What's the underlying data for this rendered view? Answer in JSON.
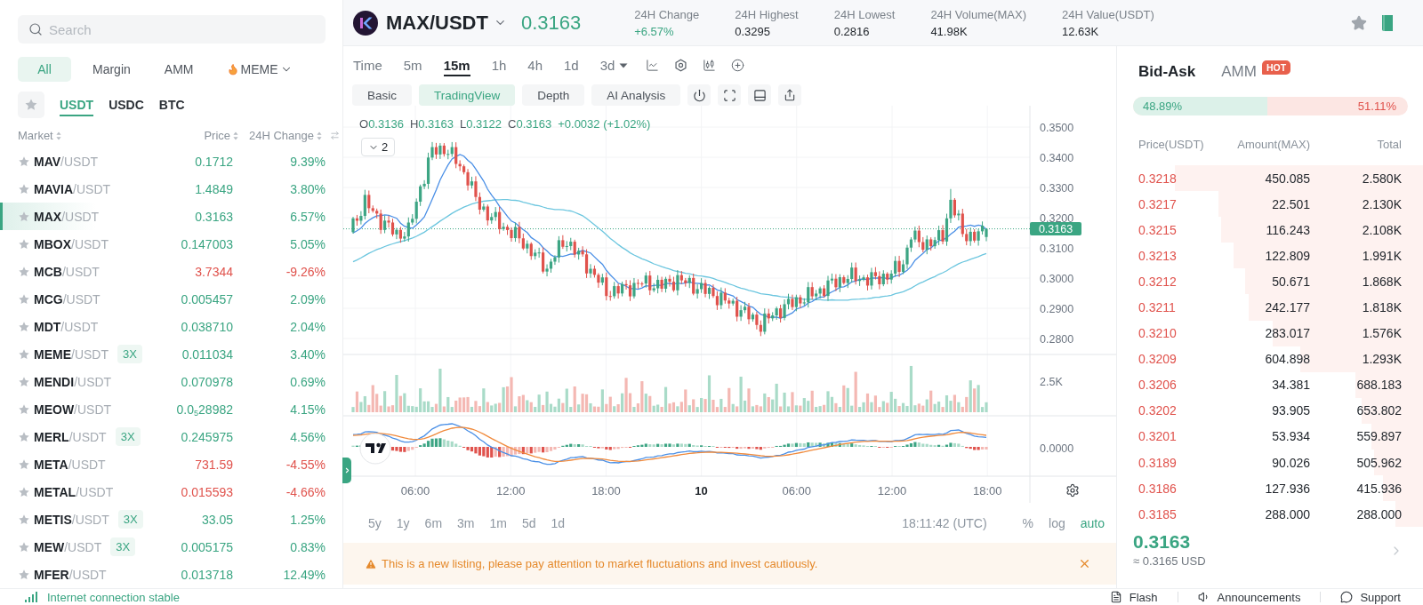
{
  "market_list": {
    "search": {
      "placeholder": "Search"
    },
    "categories": [
      {
        "label": "All",
        "selected": true,
        "kind": "tab"
      },
      {
        "label": "Margin",
        "selected": false,
        "kind": "tab"
      },
      {
        "label": "AMM",
        "selected": false,
        "kind": "tab"
      },
      {
        "label": "MEME",
        "selected": false,
        "kind": "hot-menu"
      }
    ],
    "quote_tabs": [
      {
        "label": "USDT",
        "selected": true
      },
      {
        "label": "USDC",
        "selected": false
      },
      {
        "label": "BTC",
        "selected": false
      }
    ],
    "columns": [
      "Market",
      "Price",
      "24H Change"
    ],
    "rows": [
      {
        "pair": "**MAV**/USDT",
        "price": "0.1712",
        "change": "9.39%",
        "falling": false,
        "selected": false
      },
      {
        "pair": "**MAVIA**/USDT",
        "price": "1.4849",
        "change": "3.80%",
        "falling": false,
        "selected": false
      },
      {
        "pair": "**MAX**/USDT",
        "price": "0.3163",
        "change": "6.57%",
        "falling": false,
        "selected": true
      },
      {
        "pair": "**MBOX**/USDT",
        "price": "0.147003",
        "change": "5.05%",
        "falling": false,
        "selected": false
      },
      {
        "pair": "**MCB**/USDT",
        "price": "3.7344",
        "change": "-9.26%",
        "falling": true,
        "selected": false
      },
      {
        "pair": "**MCG**/USDT",
        "price": "0.005457",
        "change": "2.09%",
        "falling": false,
        "selected": false
      },
      {
        "pair": "**MDT**/USDT",
        "price": "0.038710",
        "change": "2.04%",
        "falling": false,
        "selected": false
      },
      {
        "pair": "**MEME**/USDT",
        "leverage": "3X",
        "price": "0.011034",
        "change": "3.40%",
        "falling": false,
        "selected": false
      },
      {
        "pair": "**MENDI**/USDT",
        "price": "0.070978",
        "change": "0.69%",
        "falling": false,
        "selected": false
      },
      {
        "pair": "**MEOW**/USDT",
        "price": "0.0$_{5}$28982",
        "change": "4.15%",
        "falling": false,
        "selected": false
      },
      {
        "pair": "**MERL**/USDT",
        "leverage": "3X",
        "price": "0.245975",
        "change": "4.56%",
        "falling": false,
        "selected": false
      },
      {
        "pair": "**META**/USDT",
        "price": "731.59",
        "change": "-4.55%",
        "falling": true,
        "selected": false
      },
      {
        "pair": "**METAL**/USDT",
        "price": "0.015593",
        "change": "-4.66%",
        "falling": true,
        "selected": false
      },
      {
        "pair": "**METIS**/USDT",
        "leverage": "3X",
        "price": "33.05",
        "change": "1.25%",
        "falling": false,
        "selected": false
      },
      {
        "pair": "**MEW**/USDT",
        "leverage": "3X",
        "price": "0.005175",
        "change": "0.83%",
        "falling": false,
        "selected": false
      },
      {
        "pair": "**MFER**/USDT",
        "price": "0.013718",
        "change": "12.49%",
        "falling": false,
        "selected": false
      }
    ]
  },
  "header": {
    "symbol": "MAX/USDT",
    "price": "0.3163",
    "stats": [
      {
        "label": "24H Change",
        "value": "+6.57%",
        "kind": "change"
      },
      {
        "label": "24H Highest",
        "value": "0.3295",
        "kind": "figure"
      },
      {
        "label": "24H Lowest",
        "value": "0.2816",
        "kind": "figure"
      },
      {
        "label": "24H Volume(MAX)",
        "value": "41.98K",
        "kind": "figure"
      },
      {
        "label": "24H Value(USDT)",
        "value": "12.63K",
        "kind": "figure"
      }
    ]
  },
  "chart": {
    "intervals": [
      {
        "label": "Time",
        "selected": false,
        "kind": "option"
      },
      {
        "label": "5m",
        "selected": false,
        "kind": "option"
      },
      {
        "label": "15m",
        "selected": true,
        "kind": "option"
      },
      {
        "label": "1h",
        "selected": false,
        "kind": "option"
      },
      {
        "label": "4h",
        "selected": false,
        "kind": "option"
      },
      {
        "label": "1d",
        "selected": false,
        "kind": "option"
      },
      {
        "label": "3d",
        "selected": false,
        "kind": "menu"
      }
    ],
    "views": [
      {
        "label": "Basic",
        "selected": false
      },
      {
        "label": "TradingView",
        "selected": true
      },
      {
        "label": "Depth",
        "selected": false
      },
      {
        "label": "AI Analysis",
        "selected": false
      }
    ],
    "ohlc": [
      {
        "label": "O",
        "value": "0.3136"
      },
      {
        "label": "H",
        "value": "0.3163"
      },
      {
        "label": "L",
        "value": "0.3122"
      },
      {
        "label": "C",
        "value": "0.3163"
      }
    ],
    "change": "+0.0032 (+1.02%)",
    "indicator_count": "2",
    "price_scale": [
      "0.3500",
      "0.3400",
      "0.3300",
      "0.3200",
      "0.3100",
      "0.3000",
      "0.2900",
      "0.2800"
    ],
    "last_price_tag": "0.3163",
    "volume_scale": "2.5K",
    "macd_scale": "0.0000",
    "time_scale": [
      {
        "label": "06:00",
        "kind": "time"
      },
      {
        "label": "12:00",
        "kind": "time"
      },
      {
        "label": "18:00",
        "kind": "time"
      },
      {
        "label": "10",
        "kind": "day"
      },
      {
        "label": "06:00",
        "kind": "time"
      },
      {
        "label": "12:00",
        "kind": "time"
      },
      {
        "label": "18:00",
        "kind": "time"
      }
    ],
    "ranges": [
      "5y",
      "1y",
      "6m",
      "3m",
      "1m",
      "5d",
      "1d"
    ],
    "clock": "18:11:42 (UTC)",
    "scale_modes": [
      {
        "label": "%",
        "selected": false
      },
      {
        "label": "log",
        "selected": false
      },
      {
        "label": "auto",
        "selected": true
      }
    ]
  },
  "notice": {
    "text": "This is a new listing, please pay attention to market fluctuations and invest cautiously."
  },
  "order_book": {
    "tabs": [
      {
        "label": "Bid-Ask",
        "selected": true
      },
      {
        "label": "AMM",
        "selected": false,
        "badge": "HOT"
      }
    ],
    "ratio": {
      "buy": "48.89%",
      "sell": "51.11%",
      "level": 0.4889
    },
    "columns": [
      "Price(USDT)",
      "Amount(MAX)",
      "Total"
    ],
    "asks": [
      {
        "price": "0.3218",
        "amount": "450.085",
        "total": "2.580K",
        "level": 0.81
      },
      {
        "price": "0.3217",
        "amount": "22.501",
        "total": "2.130K",
        "level": 0.67
      },
      {
        "price": "0.3215",
        "amount": "116.243",
        "total": "2.108K",
        "level": 0.66
      },
      {
        "price": "0.3213",
        "amount": "122.809",
        "total": "1.991K",
        "level": 0.62
      },
      {
        "price": "0.3212",
        "amount": "50.671",
        "total": "1.868K",
        "level": 0.58
      },
      {
        "price": "0.3211",
        "amount": "242.177",
        "total": "1.818K",
        "level": 0.57
      },
      {
        "price": "0.3210",
        "amount": "283.017",
        "total": "1.576K",
        "level": 0.49
      },
      {
        "price": "0.3209",
        "amount": "604.898",
        "total": "1.293K",
        "level": 0.4
      },
      {
        "price": "0.3206",
        "amount": "34.381",
        "total": "688.183",
        "level": 0.22
      },
      {
        "price": "0.3202",
        "amount": "93.905",
        "total": "653.802",
        "level": 0.2
      },
      {
        "price": "0.3201",
        "amount": "53.934",
        "total": "559.897",
        "level": 0.17
      },
      {
        "price": "0.3189",
        "amount": "90.026",
        "total": "505.962",
        "level": 0.16
      },
      {
        "price": "0.3186",
        "amount": "127.936",
        "total": "415.936",
        "level": 0.13
      },
      {
        "price": "0.3185",
        "amount": "288.000",
        "total": "288.000",
        "level": 0.09
      }
    ],
    "last_price": "0.3163",
    "last_price_usd": "≈ 0.3165 USD"
  },
  "status_bar": {
    "connection": "Internet connection stable",
    "links": [
      {
        "label": "Flash",
        "kind": "document"
      },
      {
        "label": "Announcements",
        "kind": "speaker"
      },
      {
        "label": "Support",
        "kind": "chat"
      }
    ]
  }
}
